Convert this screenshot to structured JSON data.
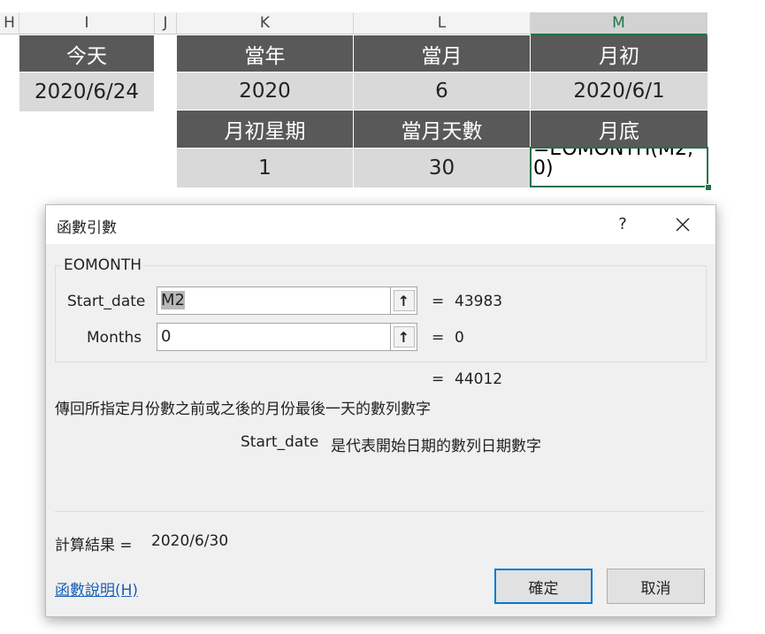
{
  "sheet": {
    "columns": [
      "H",
      "I",
      "J",
      "K",
      "L",
      "M"
    ],
    "today": {
      "header": "今天",
      "value": "2020/6/24"
    },
    "row1_headers": [
      "當年",
      "當月",
      "月初"
    ],
    "row1_values": [
      "2020",
      "6",
      "2020/6/1"
    ],
    "row2_headers": [
      "月初星期",
      "當月天數",
      "月底"
    ],
    "row2_values": [
      "1",
      "30"
    ],
    "editing_cell_text": "=EOMONTH(M2,0)"
  },
  "dialog": {
    "title": "函數引數",
    "help_label": "?",
    "function_name": "EOMONTH",
    "args": [
      {
        "label": "Start_date",
        "value": "M2",
        "result": "43983"
      },
      {
        "label": "Months",
        "value": "0",
        "result": "0"
      }
    ],
    "equals": "=",
    "total_result": "44012",
    "description": "傳回所指定月份數之前或之後的月份最後一天的數列數字",
    "arg_help_name": "Start_date",
    "arg_help_text": "是代表開始日期的數列日期數字",
    "calc_label": "計算結果 =",
    "calc_value": "2020/6/30",
    "help_link": "函數說明(H)",
    "ok_label": "確定",
    "cancel_label": "取消"
  }
}
